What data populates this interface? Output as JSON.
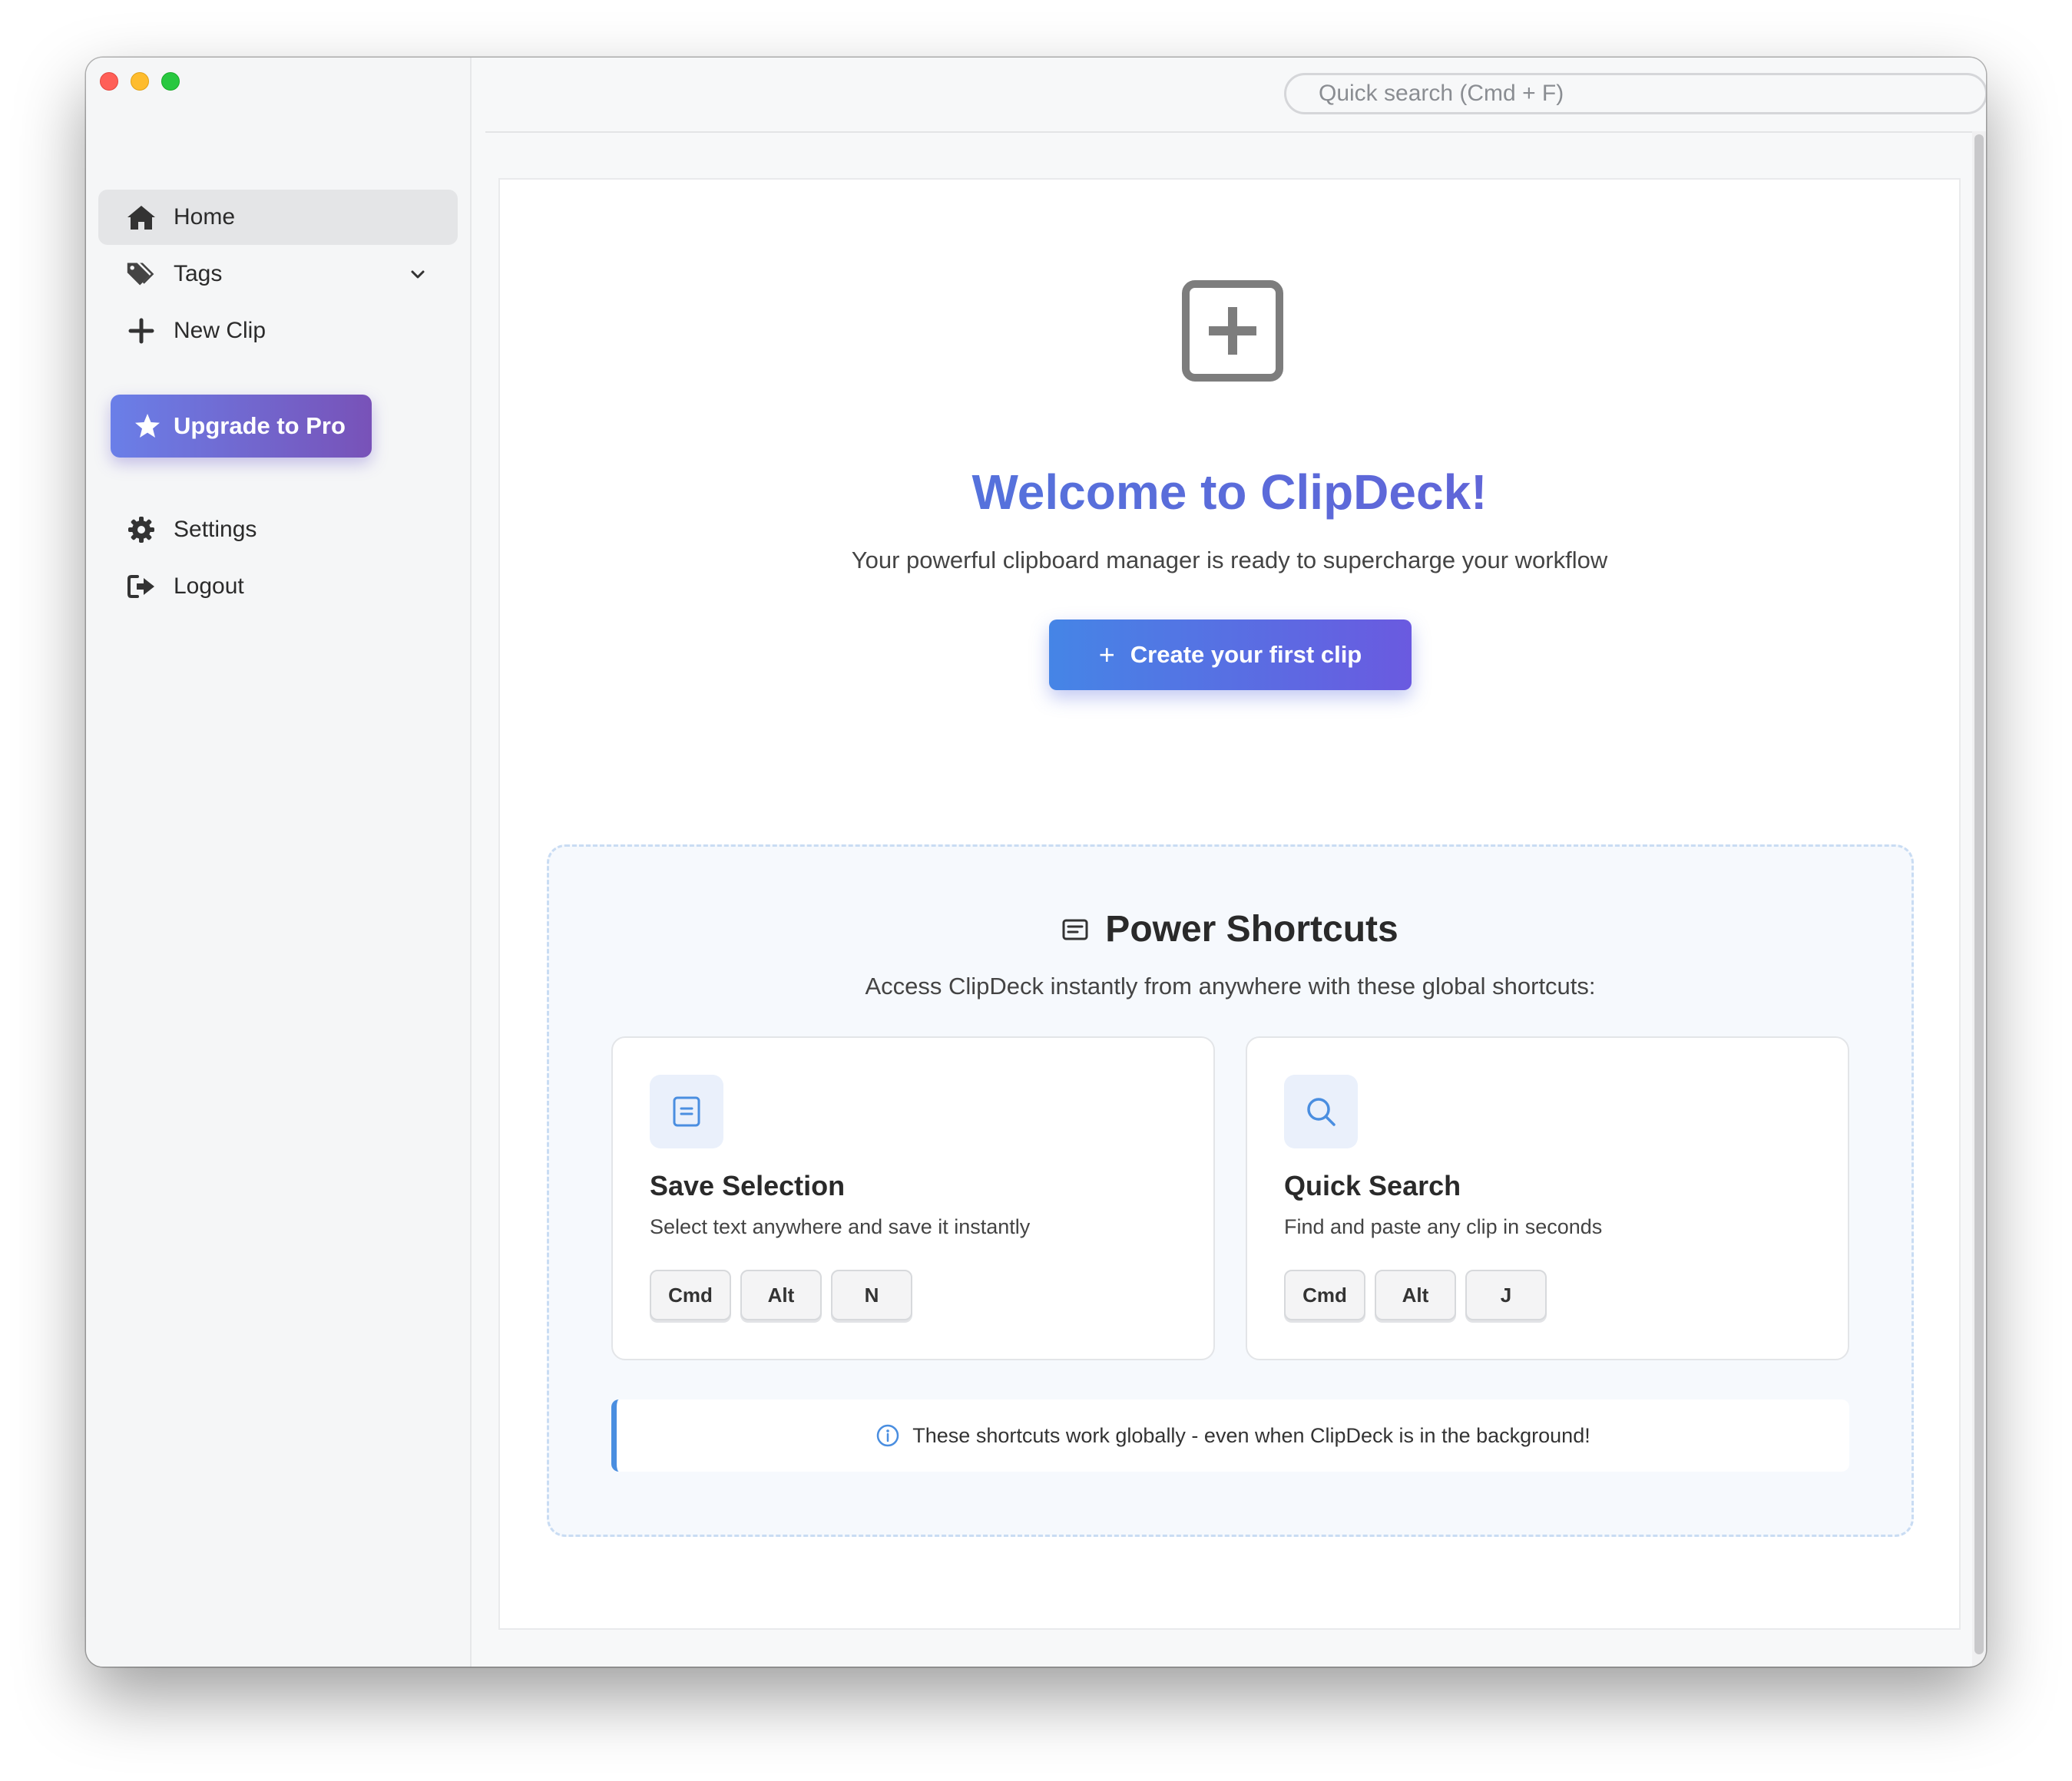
{
  "window": {
    "traffic_lights": [
      "close",
      "minimize",
      "zoom"
    ]
  },
  "search": {
    "placeholder": "Quick search (Cmd + F)"
  },
  "sidebar": {
    "items": [
      {
        "label": "Home",
        "icon": "home-icon",
        "active": true
      },
      {
        "label": "Tags",
        "icon": "tags-icon",
        "has_chevron": true
      },
      {
        "label": "New Clip",
        "icon": "plus-icon"
      }
    ],
    "upgrade_label": "Upgrade to Pro",
    "bottom_items": [
      {
        "label": "Settings",
        "icon": "gear-icon"
      },
      {
        "label": "Logout",
        "icon": "logout-icon"
      }
    ]
  },
  "hero": {
    "icon": "plus-square-icon",
    "title": "Welcome to ClipDeck!",
    "subtitle": "Your powerful clipboard manager is ready to supercharge your workflow",
    "cta_label": "Create your first clip",
    "cta_icon": "+"
  },
  "shortcuts": {
    "title": "Power Shortcuts",
    "subtitle": "Access ClipDeck instantly from anywhere with these global shortcuts:",
    "cards": [
      {
        "icon": "document-icon",
        "title": "Save Selection",
        "desc": "Select text anywhere and save it instantly",
        "keys": [
          "Cmd",
          "Alt",
          "N"
        ]
      },
      {
        "icon": "search-icon",
        "title": "Quick Search",
        "desc": "Find and paste any clip in seconds",
        "keys": [
          "Cmd",
          "Alt",
          "J"
        ]
      }
    ],
    "note": "These shortcuts work globally - even when ClipDeck is in the background!"
  },
  "colors": {
    "accent_blue": "#4b7ddf",
    "accent_purple": "#6a5ad5",
    "upgrade_start": "#6a7fe8",
    "upgrade_end": "#7852b8",
    "note_border": "#4a8ee0"
  }
}
